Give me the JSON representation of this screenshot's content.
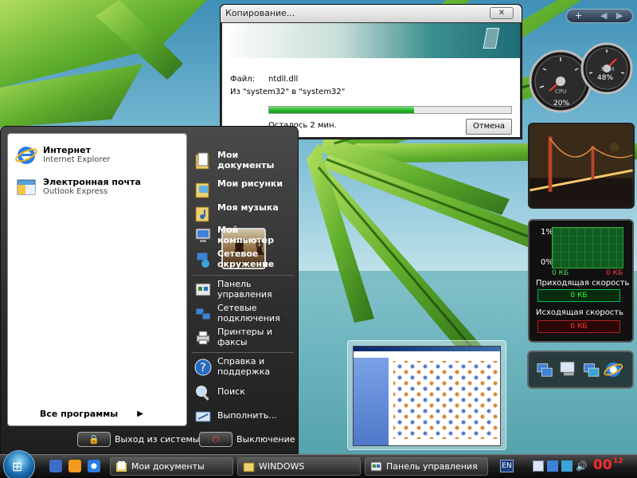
{
  "copy_dialog": {
    "title": "Копирование...",
    "close_label": "✕",
    "file_label": "Файл:",
    "file_name": "ntdll.dll",
    "from_to": "Из \"system32\" в \"system32\"",
    "progress": 0.6,
    "remaining": "Осталось 2 мин.",
    "cancel_label": "Отмена"
  },
  "start_menu": {
    "pinned": [
      {
        "title": "Интернет",
        "subtitle": "Internet Explorer",
        "icon": "internet-explorer-icon"
      },
      {
        "title": "Электронная почта",
        "subtitle": "Outlook Express",
        "icon": "outlook-express-icon"
      }
    ],
    "all_programs": "Все программы",
    "right_items": [
      {
        "label": "Мои документы",
        "icon": "my-documents-icon"
      },
      {
        "label": "Мои рисунки",
        "icon": "my-pictures-icon"
      },
      {
        "label": "Моя музыка",
        "icon": "my-music-icon"
      },
      {
        "label": "Мой компьютер",
        "icon": "my-computer-icon"
      },
      {
        "label": "Сетевое окружение",
        "icon": "network-places-icon"
      },
      {
        "label": "Панель управления",
        "icon": "control-panel-icon"
      },
      {
        "label": "Сетевые подключения",
        "icon": "network-connections-icon"
      },
      {
        "label": "Принтеры и факсы",
        "icon": "printers-icon"
      },
      {
        "label": "Справка и поддержка",
        "icon": "help-icon"
      },
      {
        "label": "Поиск",
        "icon": "search-icon"
      },
      {
        "label": "Выполнить...",
        "icon": "run-icon"
      }
    ],
    "logoff_label": "Выход из системы",
    "shutdown_label": "Выключение"
  },
  "sidebar": {
    "top_buttons": [
      "+",
      "◀",
      "▶"
    ],
    "cpu_percent": "20%",
    "mem_percent": "48%",
    "cpu_label": "CPU",
    "mem_label": "MEM",
    "network": {
      "top_pct": "1%",
      "bottom_pct": "0%",
      "kb_in": "0 КБ",
      "kb_out": "0 КБ",
      "in_label": "Приходящая скорость",
      "in_value": "0 КБ",
      "out_label": "Исходящая скорость",
      "out_value": "0 КБ"
    }
  },
  "taskbar": {
    "buttons": [
      {
        "label": "Мои документы",
        "icon": "my-documents-icon"
      },
      {
        "label": "WINDOWS",
        "icon": "folder-icon"
      },
      {
        "label": "Панель управления",
        "icon": "control-panel-icon"
      }
    ],
    "language": "EN",
    "clock_hours": "00",
    "clock_minutes": "12"
  },
  "colors": {
    "accent_green": "#21b326",
    "clock_red": "#ff2a2a"
  }
}
